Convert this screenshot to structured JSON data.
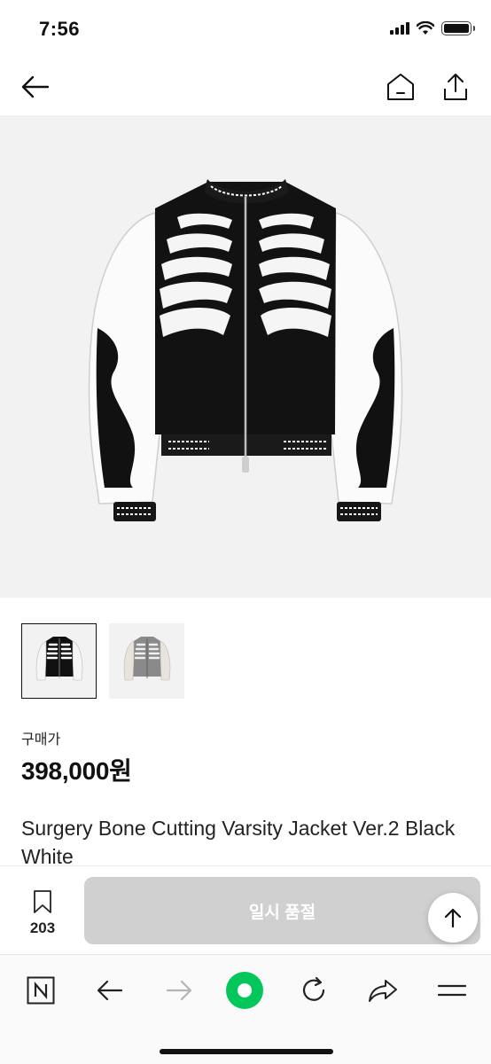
{
  "status_bar": {
    "time": "7:56"
  },
  "product": {
    "price_label": "구매가",
    "price": "398,000원",
    "title": "Surgery Bone Cutting Varsity Jacket Ver.2 Black White",
    "thumbnails": [
      {
        "variant": "black-white",
        "selected": true
      },
      {
        "variant": "grey",
        "selected": false
      }
    ]
  },
  "action_bar": {
    "bookmark_count": "203",
    "soldout_label": "일시 품절"
  },
  "icons": {
    "back": "arrow-left-icon",
    "home": "home-icon",
    "share": "share-icon",
    "bookmark": "bookmark-icon",
    "scroll_top": "arrow-up-icon",
    "browser_naver": "naver-n-icon",
    "browser_back": "arrow-left-icon",
    "browser_forward": "arrow-right-icon",
    "browser_home": "green-dot-icon",
    "browser_reload": "reload-icon",
    "browser_share": "forward-share-icon",
    "browser_menu": "menu-icon"
  },
  "colors": {
    "soldout_bg": "#d0d0d0",
    "accent_green": "#03c75a"
  }
}
